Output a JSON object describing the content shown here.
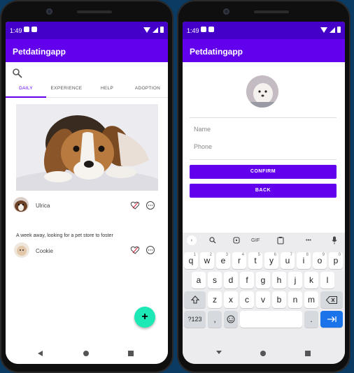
{
  "status": {
    "time": "1:49"
  },
  "app": {
    "title": "Petdatingapp"
  },
  "left": {
    "tabs": [
      "DAILY",
      "EXPERIENCE",
      "HELP",
      "ADOPTION"
    ],
    "posts": [
      {
        "user": "Ulrica",
        "text": ""
      },
      {
        "user": "Cookie",
        "text": "A week away, looking for a pet store to foster"
      }
    ],
    "fab_label": "+"
  },
  "right": {
    "name_placeholder": "Name",
    "phone_placeholder": "Phone",
    "confirm_label": "CONFIRM",
    "back_label": "BACK"
  },
  "keyboard": {
    "toolbar": {
      "gif": "GIF",
      "more": "•••"
    },
    "row1": [
      {
        "k": "q",
        "n": "1"
      },
      {
        "k": "w",
        "n": "2"
      },
      {
        "k": "e",
        "n": "3"
      },
      {
        "k": "r",
        "n": "4"
      },
      {
        "k": "t",
        "n": "5"
      },
      {
        "k": "y",
        "n": "6"
      },
      {
        "k": "u",
        "n": "7"
      },
      {
        "k": "i",
        "n": "8"
      },
      {
        "k": "o",
        "n": "9"
      },
      {
        "k": "p",
        "n": "0"
      }
    ],
    "row2": [
      "a",
      "s",
      "d",
      "f",
      "g",
      "h",
      "j",
      "k",
      "l"
    ],
    "row3": [
      "z",
      "x",
      "c",
      "v",
      "b",
      "n",
      "m"
    ],
    "sym_label": "?123",
    "comma": ",",
    "period": "."
  },
  "colors": {
    "primary": "#6200ee",
    "status": "#4400c8",
    "fab": "#1de9b6",
    "enter": "#1a73e8"
  }
}
